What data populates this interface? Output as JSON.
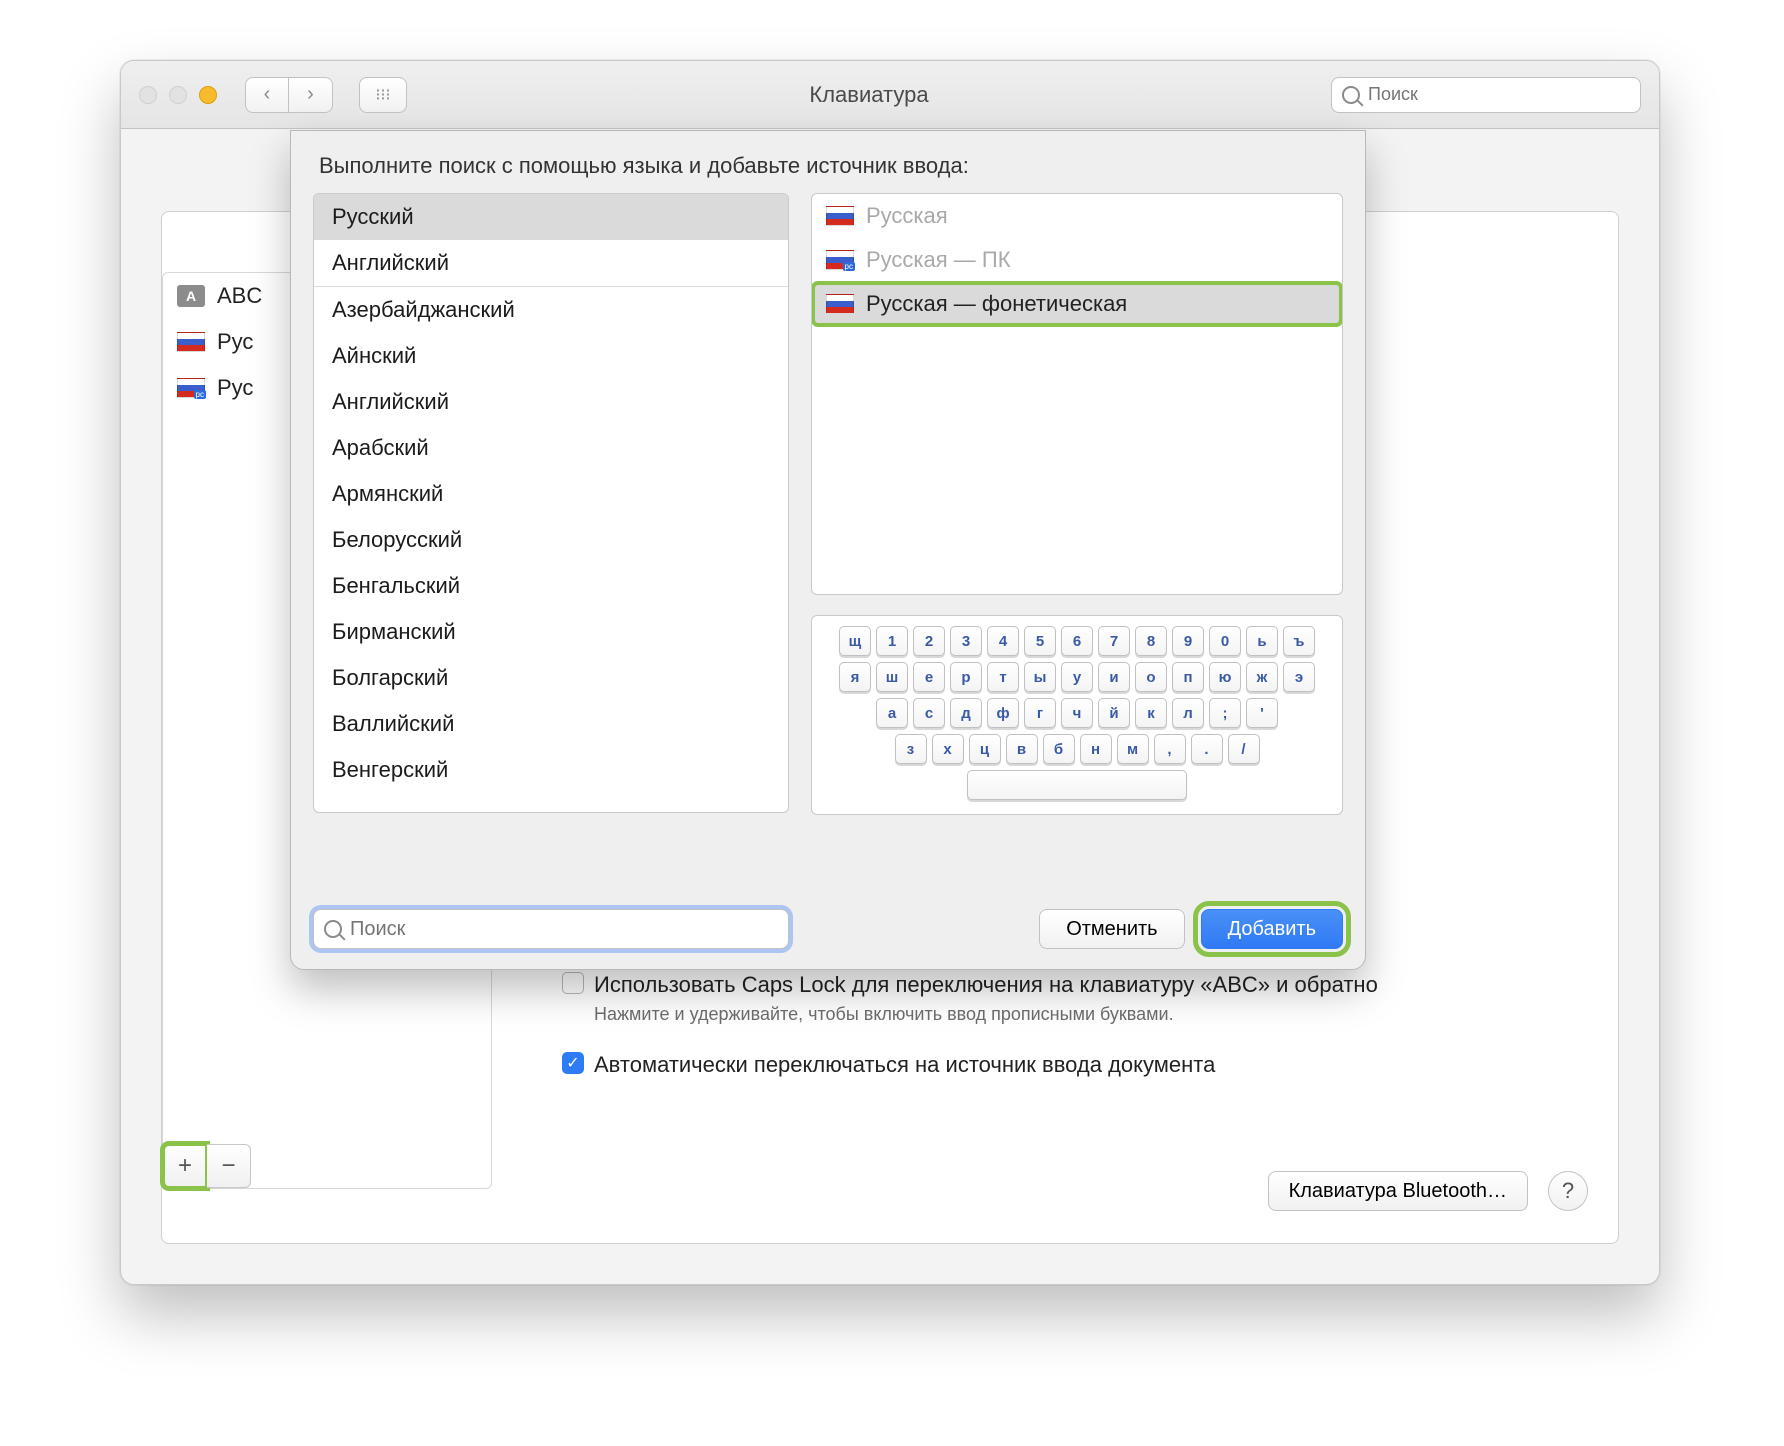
{
  "window": {
    "title": "Клавиатура",
    "search_placeholder": "Поиск"
  },
  "existing_sources": [
    {
      "icon": "abc",
      "label": "ABC"
    },
    {
      "icon": "flag-ru",
      "label": "Рус"
    },
    {
      "icon": "flag-ru-pc",
      "label": "Рус"
    }
  ],
  "checkbox1": {
    "label": "Использовать Caps Lock для переключения на клавиатуру «ABC» и обратно",
    "hint": "Нажмите и удерживайте, чтобы включить ввод прописными буквами.",
    "checked": false
  },
  "checkbox2": {
    "label": "Автоматически переключаться на источник ввода документа",
    "checked": true
  },
  "bt_button": "Клавиатура Bluetooth…",
  "sheet": {
    "prompt": "Выполните поиск с помощью языка и добавьте источник ввода:",
    "top_langs": [
      "Русский",
      "Английский"
    ],
    "langs": [
      "Азербайджанский",
      "Айнский",
      "Английский",
      "Арабский",
      "Армянский",
      "Белорусский",
      "Бенгальский",
      "Бирманский",
      "Болгарский",
      "Валлийский",
      "Венгерский"
    ],
    "selected_lang": "Русский",
    "layouts": [
      {
        "label": "Русская",
        "state": "disabled",
        "flag": "flag-ru"
      },
      {
        "label": "Русская — ПК",
        "state": "disabled",
        "flag": "flag-ru-pc"
      },
      {
        "label": "Русская — фонетическая",
        "state": "selected",
        "flag": "flag-ru"
      }
    ],
    "keyboard_rows": [
      [
        "щ",
        "1",
        "2",
        "3",
        "4",
        "5",
        "6",
        "7",
        "8",
        "9",
        "0",
        "ь",
        "ъ"
      ],
      [
        "я",
        "ш",
        "е",
        "р",
        "т",
        "ы",
        "у",
        "и",
        "о",
        "п",
        "ю",
        "ж",
        "э"
      ],
      [
        "а",
        "с",
        "д",
        "ф",
        "г",
        "ч",
        "й",
        "к",
        "л",
        ";",
        "'"
      ],
      [
        "з",
        "х",
        "ц",
        "в",
        "б",
        "н",
        "м",
        ",",
        ".",
        "/"
      ]
    ],
    "search_placeholder": "Поиск",
    "cancel": "Отменить",
    "add": "Добавить"
  }
}
